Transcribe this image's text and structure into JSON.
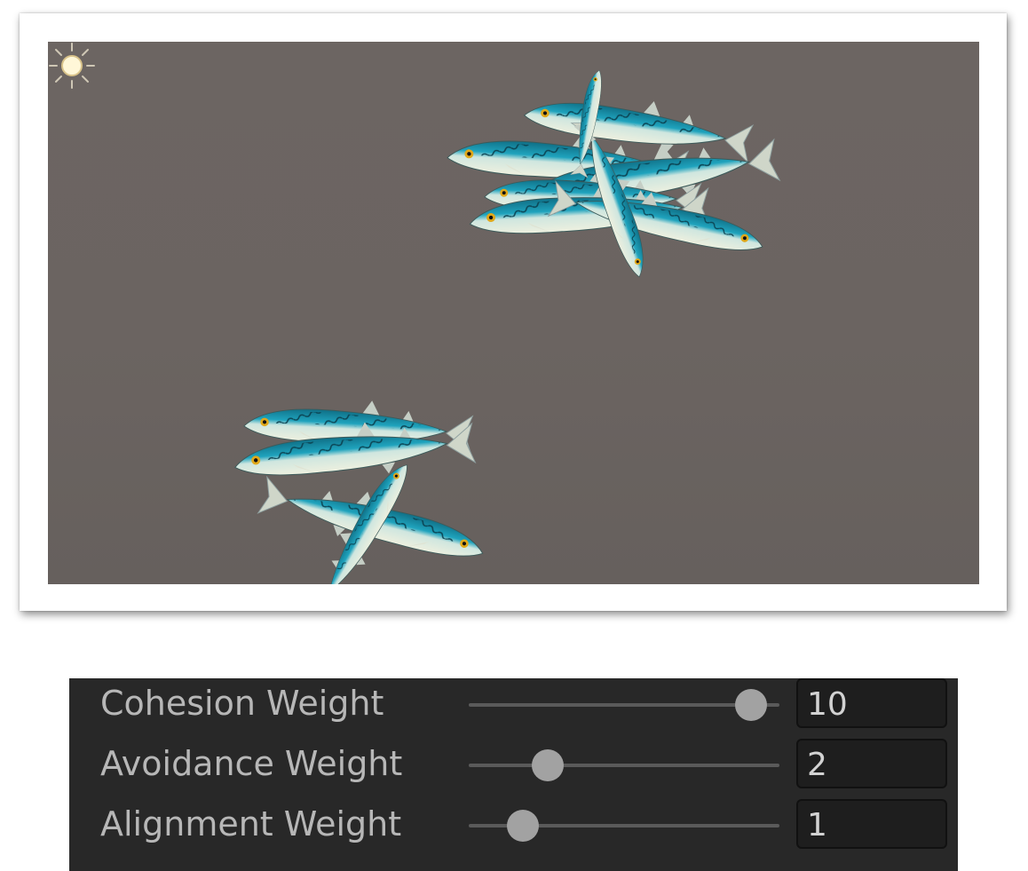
{
  "scene_view": {
    "background_color": "#6b6461",
    "objects": [
      {
        "name": "fish-school-upper",
        "count": 8
      },
      {
        "name": "fish-school-lower",
        "count": 4
      },
      {
        "name": "directional-light-gizmo"
      }
    ]
  },
  "inspector": {
    "rows": [
      {
        "label": "Cohesion Weight",
        "value": "10",
        "slider_fraction": 1.0
      },
      {
        "label": "Avoidance Weight",
        "value": "2",
        "slider_fraction": 0.2
      },
      {
        "label": "Alignment Weight",
        "value": "1",
        "slider_fraction": 0.1
      }
    ]
  },
  "colors": {
    "inspector_bg": "#282828",
    "label_text": "#b7b7b7",
    "fish_back": "#1f9bb5",
    "fish_belly": "#e8ecd9"
  }
}
